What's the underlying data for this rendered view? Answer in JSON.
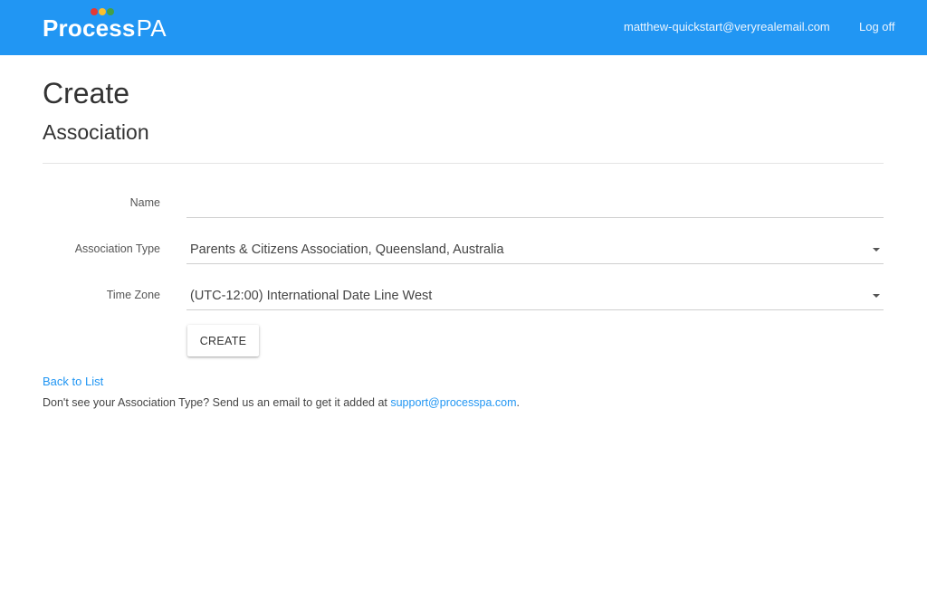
{
  "header": {
    "brand": {
      "name_bold": "Process",
      "name_light": "PA",
      "dot_colors": [
        "#e53935",
        "#fbc02d",
        "#43a047"
      ]
    },
    "user_email": "matthew-quickstart@veryrealemail.com",
    "logoff_label": "Log off"
  },
  "page": {
    "title": "Create",
    "subtitle": "Association"
  },
  "form": {
    "name": {
      "label": "Name",
      "value": ""
    },
    "association_type": {
      "label": "Association Type",
      "selected": "Parents & Citizens Association, Queensland, Australia"
    },
    "time_zone": {
      "label": "Time Zone",
      "selected": "(UTC-12:00) International Date Line West"
    },
    "create_label": "CREATE"
  },
  "footer": {
    "back_label": "Back to List",
    "help_text": "Don't see your Association Type? Send us an email to get it added at ",
    "support_email": "support@processpa.com",
    "help_suffix": "."
  },
  "colors": {
    "accent": "#2196f3"
  }
}
